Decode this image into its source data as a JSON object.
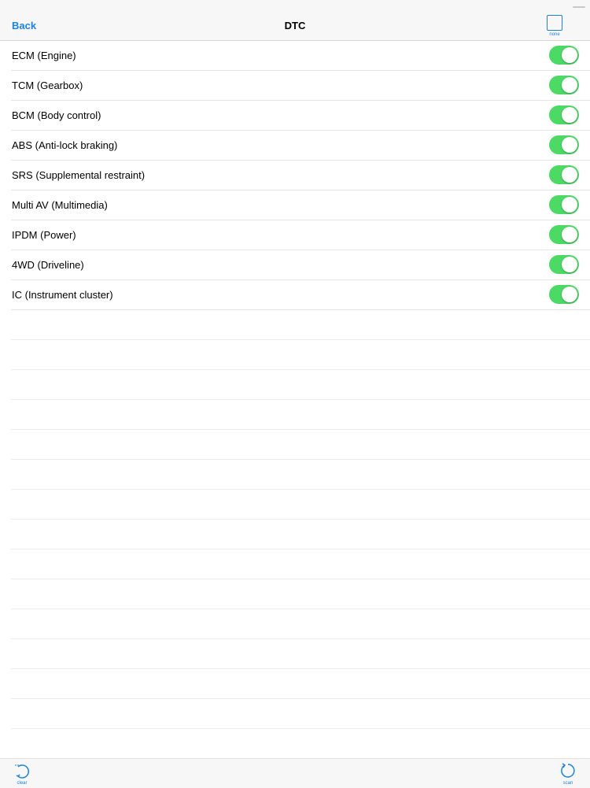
{
  "nav": {
    "back_label": "Back",
    "title": "DTC",
    "none_label": "none"
  },
  "modules": [
    {
      "label": "ECM (Engine)",
      "enabled": true
    },
    {
      "label": "TCM (Gearbox)",
      "enabled": true
    },
    {
      "label": "BCM (Body control)",
      "enabled": true
    },
    {
      "label": "ABS (Anti-lock braking)",
      "enabled": true
    },
    {
      "label": "SRS (Supplemental restraint)",
      "enabled": true
    },
    {
      "label": "Multi AV (Multimedia)",
      "enabled": true
    },
    {
      "label": "IPDM (Power)",
      "enabled": true
    },
    {
      "label": "4WD (Driveline)",
      "enabled": true
    },
    {
      "label": "IC (Instrument cluster)",
      "enabled": true
    }
  ],
  "toolbar": {
    "clear_label": "clear",
    "scan_label": "scan"
  },
  "colors": {
    "accent": "#1a82e2",
    "toggle_on": "#4cd964"
  },
  "icons": {
    "clear": "undo-arrow-icon",
    "scan": "refresh-icon",
    "none": "empty-checkbox-icon"
  }
}
